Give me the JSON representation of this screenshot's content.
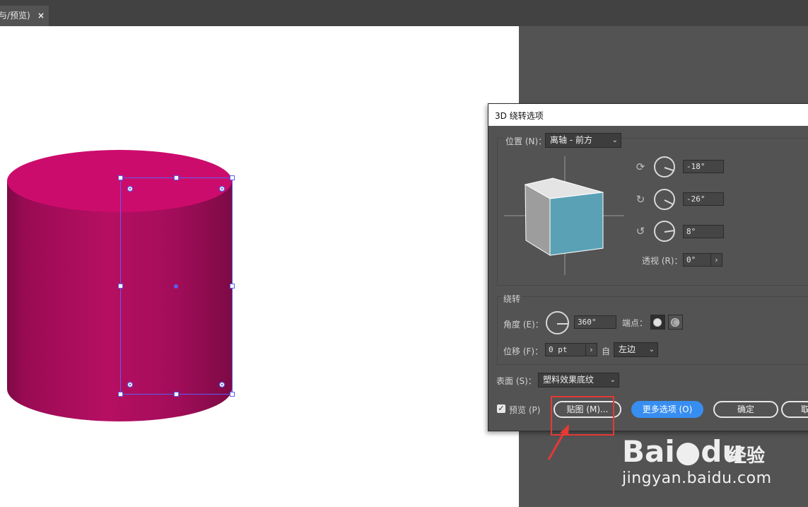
{
  "document_tab": {
    "title": "与/预览)",
    "close_glyph": "×"
  },
  "colors": {
    "cylinder_top": "#cc0c6c",
    "cylinder_side_light": "#b60f62",
    "cylinder_side_dark": "#7d0a45",
    "cube_front": "#5aa1b6",
    "cube_left": "#9d9d9d",
    "cube_top": "#e4e4e4",
    "selection": "#5a5ff0",
    "accent_button": "#378ef0",
    "highlight_box": "#e53935"
  },
  "dialog": {
    "title": "3D 绕转选项",
    "position": {
      "label": "位置 (N)：",
      "value": "离轴 - 前方",
      "rotate_x": {
        "icon": "rotate-x-icon",
        "value": "-18°"
      },
      "rotate_y": {
        "icon": "rotate-y-icon",
        "value": "-26°"
      },
      "rotate_z": {
        "icon": "rotate-z-icon",
        "value": "8°"
      },
      "perspective_label": "透视 (R)：",
      "perspective_value": "0°"
    },
    "revolve": {
      "section_label": "绕转",
      "angle_label": "角度 (E)：",
      "angle_value": "360°",
      "cap_label": "端点：",
      "offset_label": "位移 (F)：",
      "offset_value": "0 pt",
      "from_label": "自",
      "from_value": "左边"
    },
    "surface": {
      "label": "表面 (S)：",
      "value": "塑料效果底纹"
    },
    "preview": {
      "label": "预览 (P)",
      "checked": true
    },
    "buttons": {
      "map": "贴图 (M)...",
      "more_options": "更多选项 (O)",
      "ok": "确定",
      "cancel": "取"
    }
  },
  "watermark": {
    "brand": "Bai●du",
    "product": "经验",
    "url": "jingyan.baidu.com"
  }
}
